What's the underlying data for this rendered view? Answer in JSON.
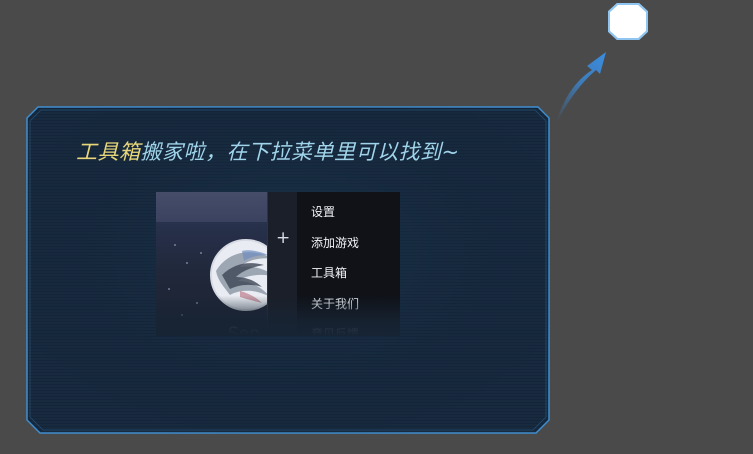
{
  "tip": {
    "title_highlight": "工具箱",
    "title_rest": "搬家啦，在下拉菜单里可以找到~"
  },
  "preview": {
    "user_name": "Sen",
    "plus_symbol": "+",
    "menu": [
      {
        "label": "设置"
      },
      {
        "label": "添加游戏"
      },
      {
        "label": "工具箱"
      },
      {
        "label": "关于我们"
      },
      {
        "label": "意见反馈"
      }
    ]
  },
  "colors": {
    "background": "#4a4a4a",
    "panel_fill": "#16283c",
    "panel_border": "#3f8ecf",
    "title_highlight": "#e8d77a",
    "title_text": "#9fd4ea",
    "arrow": "#3a8de0"
  },
  "icons": {
    "corner_button": "octagon-button-icon",
    "pointer": "curved-arrow-icon",
    "add": "plus-icon"
  }
}
